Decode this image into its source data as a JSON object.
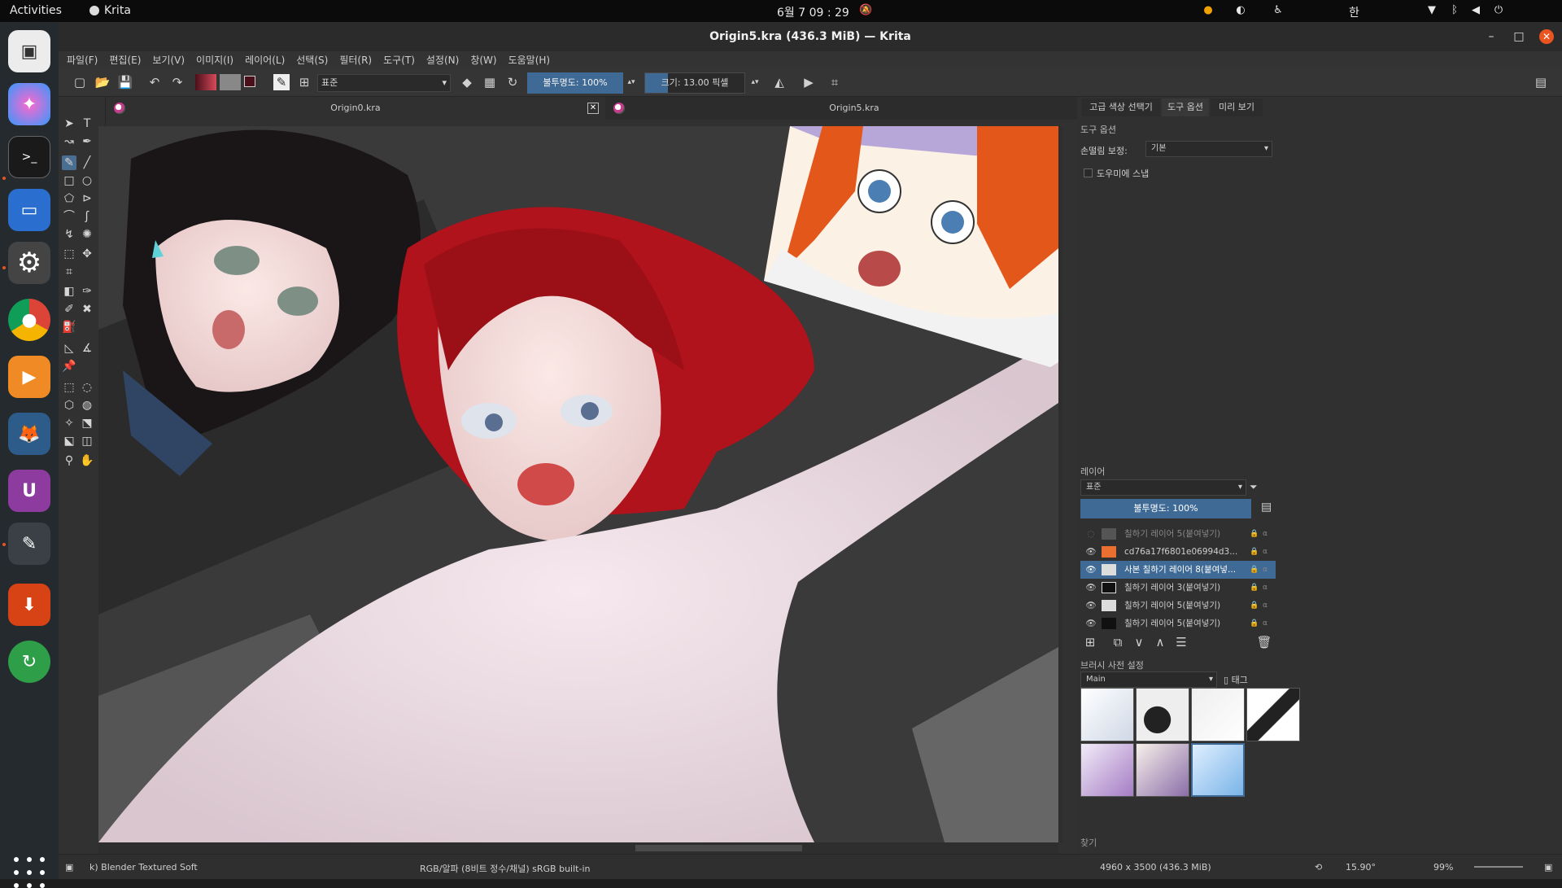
{
  "topbar": {
    "activities": "Activities",
    "app_name": "Krita",
    "clock": "6월 7  09 : 29",
    "ime": "한"
  },
  "window": {
    "title": "Origin5.kra (436.3 MiB) — Krita"
  },
  "menu": [
    "파일(F)",
    "편집(E)",
    "보기(V)",
    "이미지(I)",
    "레이어(L)",
    "선택(S)",
    "필터(R)",
    "도구(T)",
    "설정(N)",
    "창(W)",
    "도움말(H)"
  ],
  "toolbar": {
    "blend_mode": "표준",
    "opacity": "불투명도: 100%",
    "size": "크기: 13.00 픽셀"
  },
  "tabs": [
    {
      "label": "Origin0.kra"
    },
    {
      "label": "Origin5.kra"
    }
  ],
  "dockers": {
    "tabs": [
      "고급 색상 선택기",
      "도구 옵션",
      "미리 보기"
    ],
    "tool_options_title": "도구 옵션",
    "smoothing_label": "손떨림 보정:",
    "smoothing_value": "기본",
    "assistant_snap": "도우미에 스냅",
    "layers_title": "레이어",
    "layer_blend": "표준",
    "layer_opacity": "불투명도: 100%",
    "layers": [
      {
        "name": "칠하기 레이어 5(붙여넣기)",
        "visible": false
      },
      {
        "name": "cd76a17f6801e06994d3...",
        "visible": true
      },
      {
        "name": "사본 칠하기 레이어 8(붙여넣...",
        "visible": true
      },
      {
        "name": "칠하기 레이어 3(붙여넣기)",
        "visible": true
      },
      {
        "name": "칠하기 레이어 5(붙여넣기)",
        "visible": true
      },
      {
        "name": "칠하기 레이어 5(붙여넣기)",
        "visible": true
      }
    ],
    "brush_presets_title": "브러시 사전 설정",
    "preset_group": "Main",
    "tag_label": "태그",
    "search_placeholder": "찾기"
  },
  "status": {
    "brush": "k) Blender Textured Soft",
    "color_space": "RGB/알파 (8비트 정수/채널)  sRGB built-in",
    "size": "4960 x 3500 (436.3 MiB)",
    "rotation": "15.90°",
    "zoom": "99%"
  },
  "colors": {
    "accent": "#3f6a95",
    "ubuntu_orange": "#e95420",
    "foreground_color": "#4a0f1a",
    "background_color": "#ffffff"
  }
}
